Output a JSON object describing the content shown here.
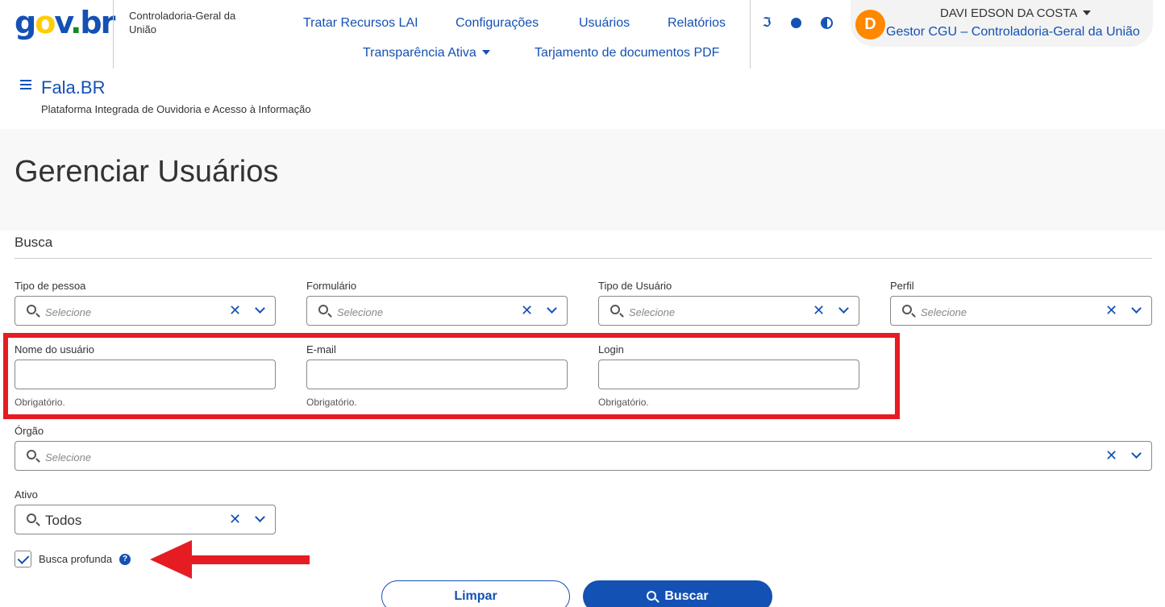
{
  "header": {
    "logo": {
      "g": "g",
      "o": "o",
      "v": "v",
      "dot": ".",
      "br": "br"
    },
    "org_name": "Controladoria-Geral da União",
    "nav": {
      "tratar_recursos": "Tratar Recursos LAI",
      "configuracoes": "Configurações",
      "usuarios": "Usuários",
      "relatorios": "Relatórios",
      "transparencia": "Transparência Ativa",
      "tarjamento": "Tarjamento de documentos PDF"
    },
    "tools": {
      "accessibility_icon": "hearing-icon",
      "cookie_icon": "cookie-icon",
      "contrast_icon": "contrast-icon",
      "accessibility_glyph": "ℑ"
    },
    "user": {
      "avatar_letter": "D",
      "name": "DAVI EDSON DA COSTA",
      "role": "Gestor CGU – Controladoria-Geral da União"
    },
    "app_title": "Fala.BR",
    "app_subtitle": "Plataforma Integrada de Ouvidoria e Acesso à Informação"
  },
  "page": {
    "title": "Gerenciar Usuários",
    "section": "Busca"
  },
  "filters": {
    "tipo_pessoa": {
      "label": "Tipo de pessoa",
      "placeholder": "Selecione"
    },
    "formulario": {
      "label": "Formulário",
      "placeholder": "Selecione"
    },
    "tipo_usuario": {
      "label": "Tipo de Usuário",
      "placeholder": "Selecione"
    },
    "perfil": {
      "label": "Perfil",
      "placeholder": "Selecione"
    },
    "nome_usuario": {
      "label": "Nome do usuário",
      "value": "",
      "helper": "Obrigatório."
    },
    "email": {
      "label": "E-mail",
      "value": "",
      "helper": "Obrigatório."
    },
    "login": {
      "label": "Login",
      "value": "",
      "helper": "Obrigatório."
    },
    "orgao": {
      "label": "Órgão",
      "placeholder": "Selecione"
    },
    "ativo": {
      "label": "Ativo",
      "value": "Todos"
    },
    "busca_profunda": {
      "label": "Busca profunda",
      "checked": true,
      "help": "?"
    }
  },
  "actions": {
    "clear": "Limpar",
    "search": "Buscar"
  },
  "glyphs": {
    "clear": "✕"
  },
  "colors": {
    "primary": "#1351b4",
    "annotation_red": "#e51c23",
    "avatar": "#ff8800"
  }
}
